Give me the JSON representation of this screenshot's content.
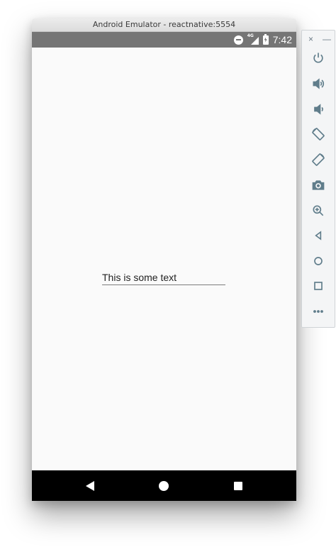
{
  "window": {
    "title": "Android Emulator - reactnative:5554"
  },
  "status_bar": {
    "network_type": "4G",
    "time": "7:42",
    "icons": [
      "do-not-disturb-icon",
      "signal-icon",
      "battery-charging-icon"
    ]
  },
  "app": {
    "text_input_value": "This is some text"
  },
  "nav_bar": {
    "buttons": [
      "back-icon",
      "home-icon",
      "recents-icon"
    ]
  },
  "toolbar": {
    "close_label": "×",
    "minimize_label": "—",
    "items": [
      "power-icon",
      "volume-up-icon",
      "volume-down-icon",
      "rotate-left-icon",
      "rotate-right-icon",
      "camera-icon",
      "zoom-icon",
      "back-icon",
      "home-icon",
      "overview-icon",
      "more-icon"
    ]
  },
  "colors": {
    "status_bar": "#757575",
    "nav_bar": "#000000",
    "app_background": "#fafafa",
    "toolbar_icon": "#607d8b"
  }
}
